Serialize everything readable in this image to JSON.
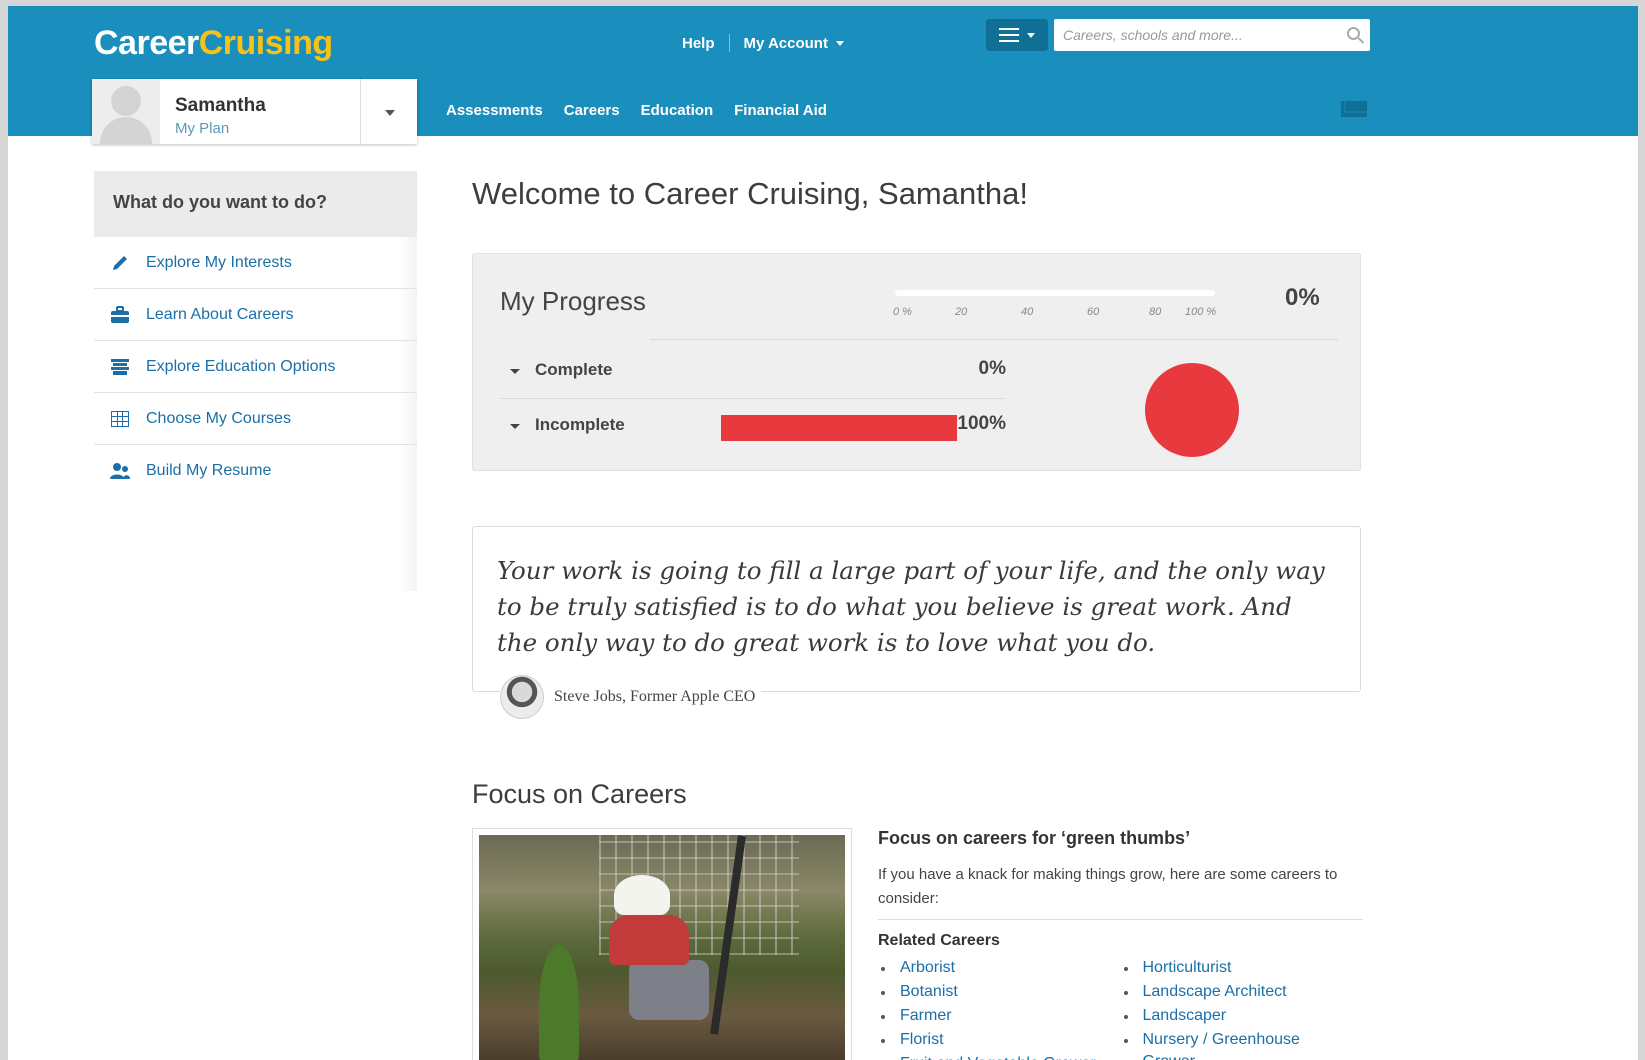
{
  "logo": {
    "part1": "Career",
    "part2": "Cruising"
  },
  "top_links": {
    "help": "Help",
    "account": "My Account"
  },
  "search": {
    "placeholder": "Careers, schools and more..."
  },
  "nav": [
    "Assessments",
    "Careers",
    "Education",
    "Financial Aid"
  ],
  "user": {
    "name": "Samantha",
    "subtitle": "My Plan"
  },
  "sidebar": {
    "heading": "What do you want to do?",
    "items": [
      {
        "label": "Explore My Interests",
        "icon": "pencil-icon"
      },
      {
        "label": "Learn About Careers",
        "icon": "briefcase-icon"
      },
      {
        "label": "Explore Education Options",
        "icon": "school-icon"
      },
      {
        "label": "Choose My Courses",
        "icon": "calendar-grid-icon"
      },
      {
        "label": "Build My Resume",
        "icon": "people-icon"
      }
    ]
  },
  "welcome": "Welcome to Career Cruising, Samantha!",
  "progress": {
    "title": "My Progress",
    "total": "0%",
    "scale_labels": [
      "0 %",
      "20",
      "40",
      "60",
      "80",
      "100 %"
    ],
    "rows": [
      {
        "label": "Complete",
        "value": "0%",
        "fraction": 0
      },
      {
        "label": "Incomplete",
        "value": "100%",
        "fraction": 1.0
      }
    ],
    "colors": {
      "incomplete": "#e8393f",
      "complete": "#1a8ebd"
    }
  },
  "quote": {
    "text": "Your work is going to fill a large part of your life, and the only way to be truly satisfied is to do what you believe is great work. And the only way to do great work is to love what you do.",
    "author": "Steve Jobs, Former Apple CEO"
  },
  "focus": {
    "section_title": "Focus on Careers",
    "title": "Focus on careers for ‘green thumbs’",
    "description": "If you have a knack for making things grow, here are some careers to consider:",
    "related_heading": "Related Careers",
    "col1": [
      "Arborist",
      "Botanist",
      "Farmer",
      "Florist",
      "Fruit and Vegetable Grower"
    ],
    "col2": [
      "Horticulturist",
      "Landscape Architect",
      "Landscaper",
      "Nursery / Greenhouse",
      "Grower"
    ]
  },
  "colors": {
    "header": "#1a8ebd",
    "logo_accent": "#f6c218",
    "link": "#1a6fa8"
  }
}
